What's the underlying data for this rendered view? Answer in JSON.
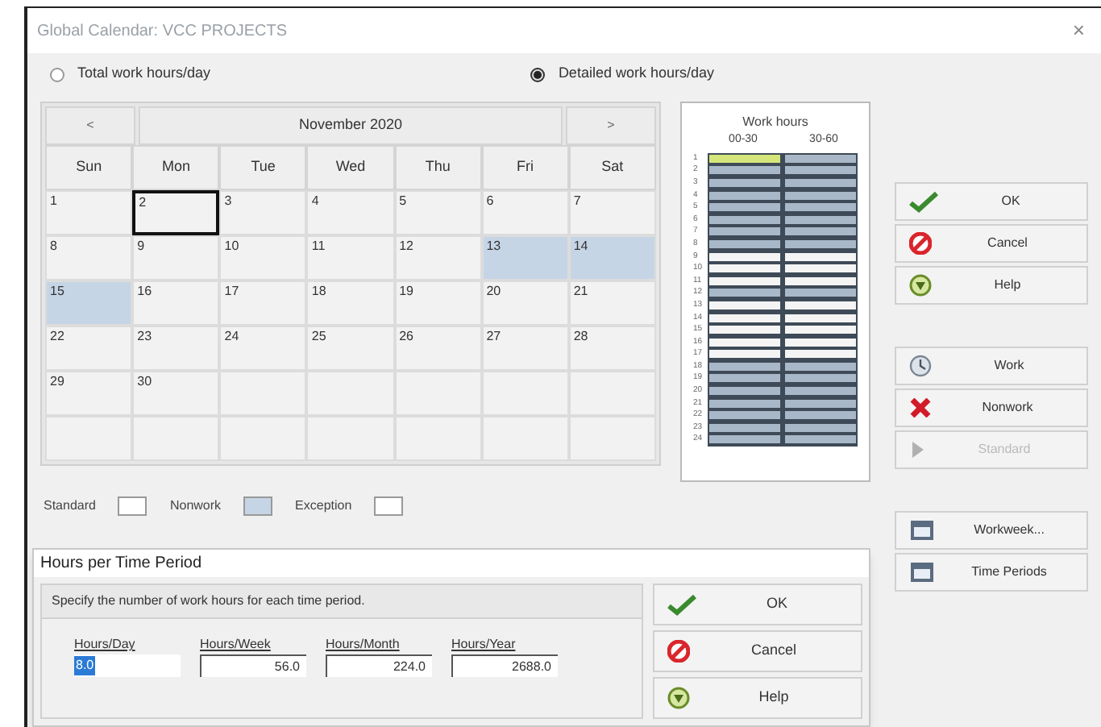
{
  "window": {
    "title": "Global Calendar: VCC PROJECTS",
    "close": "×"
  },
  "modes": [
    {
      "label": "Total work hours/day",
      "selected": false
    },
    {
      "label": "Detailed work hours/day",
      "selected": true
    }
  ],
  "calendar": {
    "prev": "<",
    "month": "November 2020",
    "next": ">",
    "weekdays": [
      "Sun",
      "Mon",
      "Tue",
      "Wed",
      "Thu",
      "Fri",
      "Sat"
    ],
    "days": [
      {
        "day": "1",
        "nonwork": false,
        "selected": false
      },
      {
        "day": "2",
        "nonwork": false,
        "selected": true
      },
      {
        "day": "3",
        "nonwork": false,
        "selected": false
      },
      {
        "day": "4",
        "nonwork": false,
        "selected": false
      },
      {
        "day": "5",
        "nonwork": false,
        "selected": false
      },
      {
        "day": "6",
        "nonwork": false,
        "selected": false
      },
      {
        "day": "7",
        "nonwork": false,
        "selected": false
      },
      {
        "day": "8",
        "nonwork": false,
        "selected": false
      },
      {
        "day": "9",
        "nonwork": false,
        "selected": false
      },
      {
        "day": "10",
        "nonwork": false,
        "selected": false
      },
      {
        "day": "11",
        "nonwork": false,
        "selected": false
      },
      {
        "day": "12",
        "nonwork": false,
        "selected": false
      },
      {
        "day": "13",
        "nonwork": true,
        "selected": false
      },
      {
        "day": "14",
        "nonwork": true,
        "selected": false
      },
      {
        "day": "15",
        "nonwork": true,
        "selected": false
      },
      {
        "day": "16",
        "nonwork": false,
        "selected": false
      },
      {
        "day": "17",
        "nonwork": false,
        "selected": false
      },
      {
        "day": "18",
        "nonwork": false,
        "selected": false
      },
      {
        "day": "19",
        "nonwork": false,
        "selected": false
      },
      {
        "day": "20",
        "nonwork": false,
        "selected": false
      },
      {
        "day": "21",
        "nonwork": false,
        "selected": false
      },
      {
        "day": "22",
        "nonwork": false,
        "selected": false
      },
      {
        "day": "23",
        "nonwork": false,
        "selected": false
      },
      {
        "day": "24",
        "nonwork": false,
        "selected": false
      },
      {
        "day": "25",
        "nonwork": false,
        "selected": false
      },
      {
        "day": "26",
        "nonwork": false,
        "selected": false
      },
      {
        "day": "27",
        "nonwork": false,
        "selected": false
      },
      {
        "day": "28",
        "nonwork": false,
        "selected": false
      },
      {
        "day": "29",
        "nonwork": false,
        "selected": false
      },
      {
        "day": "30",
        "nonwork": false,
        "selected": false
      }
    ]
  },
  "work_hours": {
    "title": "Work hours",
    "columns": [
      "00-30",
      "30-60"
    ],
    "rows": [
      {
        "label": "1",
        "slots": [
          {
            "work": false,
            "selected": true
          },
          {
            "work": false,
            "selected": false
          }
        ]
      },
      {
        "label": "2",
        "slots": [
          {
            "work": false,
            "selected": false
          },
          {
            "work": false,
            "selected": false
          }
        ]
      },
      {
        "label": "3",
        "slots": [
          {
            "work": false,
            "selected": false
          },
          {
            "work": false,
            "selected": false
          }
        ]
      },
      {
        "label": "4",
        "slots": [
          {
            "work": false,
            "selected": false
          },
          {
            "work": false,
            "selected": false
          }
        ]
      },
      {
        "label": "5",
        "slots": [
          {
            "work": false,
            "selected": false
          },
          {
            "work": false,
            "selected": false
          }
        ]
      },
      {
        "label": "6",
        "slots": [
          {
            "work": false,
            "selected": false
          },
          {
            "work": false,
            "selected": false
          }
        ]
      },
      {
        "label": "7",
        "slots": [
          {
            "work": false,
            "selected": false
          },
          {
            "work": false,
            "selected": false
          }
        ]
      },
      {
        "label": "8",
        "slots": [
          {
            "work": false,
            "selected": false
          },
          {
            "work": false,
            "selected": false
          }
        ]
      },
      {
        "label": "9",
        "slots": [
          {
            "work": true,
            "selected": false
          },
          {
            "work": true,
            "selected": false
          }
        ]
      },
      {
        "label": "10",
        "slots": [
          {
            "work": true,
            "selected": false
          },
          {
            "work": true,
            "selected": false
          }
        ]
      },
      {
        "label": "11",
        "slots": [
          {
            "work": true,
            "selected": false
          },
          {
            "work": true,
            "selected": false
          }
        ]
      },
      {
        "label": "12",
        "slots": [
          {
            "work": false,
            "selected": false
          },
          {
            "work": false,
            "selected": false
          }
        ]
      },
      {
        "label": "13",
        "slots": [
          {
            "work": true,
            "selected": false
          },
          {
            "work": true,
            "selected": false
          }
        ]
      },
      {
        "label": "14",
        "slots": [
          {
            "work": true,
            "selected": false
          },
          {
            "work": true,
            "selected": false
          }
        ]
      },
      {
        "label": "15",
        "slots": [
          {
            "work": true,
            "selected": false
          },
          {
            "work": true,
            "selected": false
          }
        ]
      },
      {
        "label": "16",
        "slots": [
          {
            "work": true,
            "selected": false
          },
          {
            "work": true,
            "selected": false
          }
        ]
      },
      {
        "label": "17",
        "slots": [
          {
            "work": true,
            "selected": false
          },
          {
            "work": true,
            "selected": false
          }
        ]
      },
      {
        "label": "18",
        "slots": [
          {
            "work": false,
            "selected": false
          },
          {
            "work": false,
            "selected": false
          }
        ]
      },
      {
        "label": "19",
        "slots": [
          {
            "work": false,
            "selected": false
          },
          {
            "work": false,
            "selected": false
          }
        ]
      },
      {
        "label": "20",
        "slots": [
          {
            "work": false,
            "selected": false
          },
          {
            "work": false,
            "selected": false
          }
        ]
      },
      {
        "label": "21",
        "slots": [
          {
            "work": false,
            "selected": false
          },
          {
            "work": false,
            "selected": false
          }
        ]
      },
      {
        "label": "22",
        "slots": [
          {
            "work": false,
            "selected": false
          },
          {
            "work": false,
            "selected": false
          }
        ]
      },
      {
        "label": "23",
        "slots": [
          {
            "work": false,
            "selected": false
          },
          {
            "work": false,
            "selected": false
          }
        ]
      },
      {
        "label": "24",
        "slots": [
          {
            "work": false,
            "selected": false
          },
          {
            "work": false,
            "selected": false
          }
        ]
      }
    ]
  },
  "legend": [
    {
      "label": "Standard",
      "color": "#ffffff"
    },
    {
      "label": "Nonwork",
      "color": "#c5d5e6"
    },
    {
      "label": "Exception",
      "color": "#ffffff"
    }
  ],
  "buttons": [
    {
      "kind": "ok",
      "label": "OK",
      "disabled": false
    },
    {
      "kind": "cancel",
      "label": "Cancel",
      "disabled": false
    },
    {
      "kind": "help",
      "label": "Help",
      "disabled": false
    },
    {
      "kind": "work",
      "label": "Work",
      "disabled": false
    },
    {
      "kind": "nonwork",
      "label": "Nonwork",
      "disabled": false
    },
    {
      "kind": "standard",
      "label": "Standard",
      "disabled": true
    },
    {
      "kind": "calendar",
      "label": "Workweek...",
      "disabled": false
    },
    {
      "kind": "calendar",
      "label": "Time Periods",
      "disabled": false
    }
  ],
  "dialog": {
    "title": "Hours per Time Period",
    "instruction": "Specify the number of work hours for each time period.",
    "fields": [
      {
        "label": "Hours/Day",
        "value": "8.0",
        "selected": true
      },
      {
        "label": "Hours/Week",
        "value": "56.0",
        "selected": false
      },
      {
        "label": "Hours/Month",
        "value": "224.0",
        "selected": false
      },
      {
        "label": "Hours/Year",
        "value": "2688.0",
        "selected": false
      }
    ],
    "buttons": [
      {
        "kind": "ok",
        "label": "OK"
      },
      {
        "kind": "cancel",
        "label": "Cancel"
      },
      {
        "kind": "help",
        "label": "Help"
      }
    ]
  }
}
